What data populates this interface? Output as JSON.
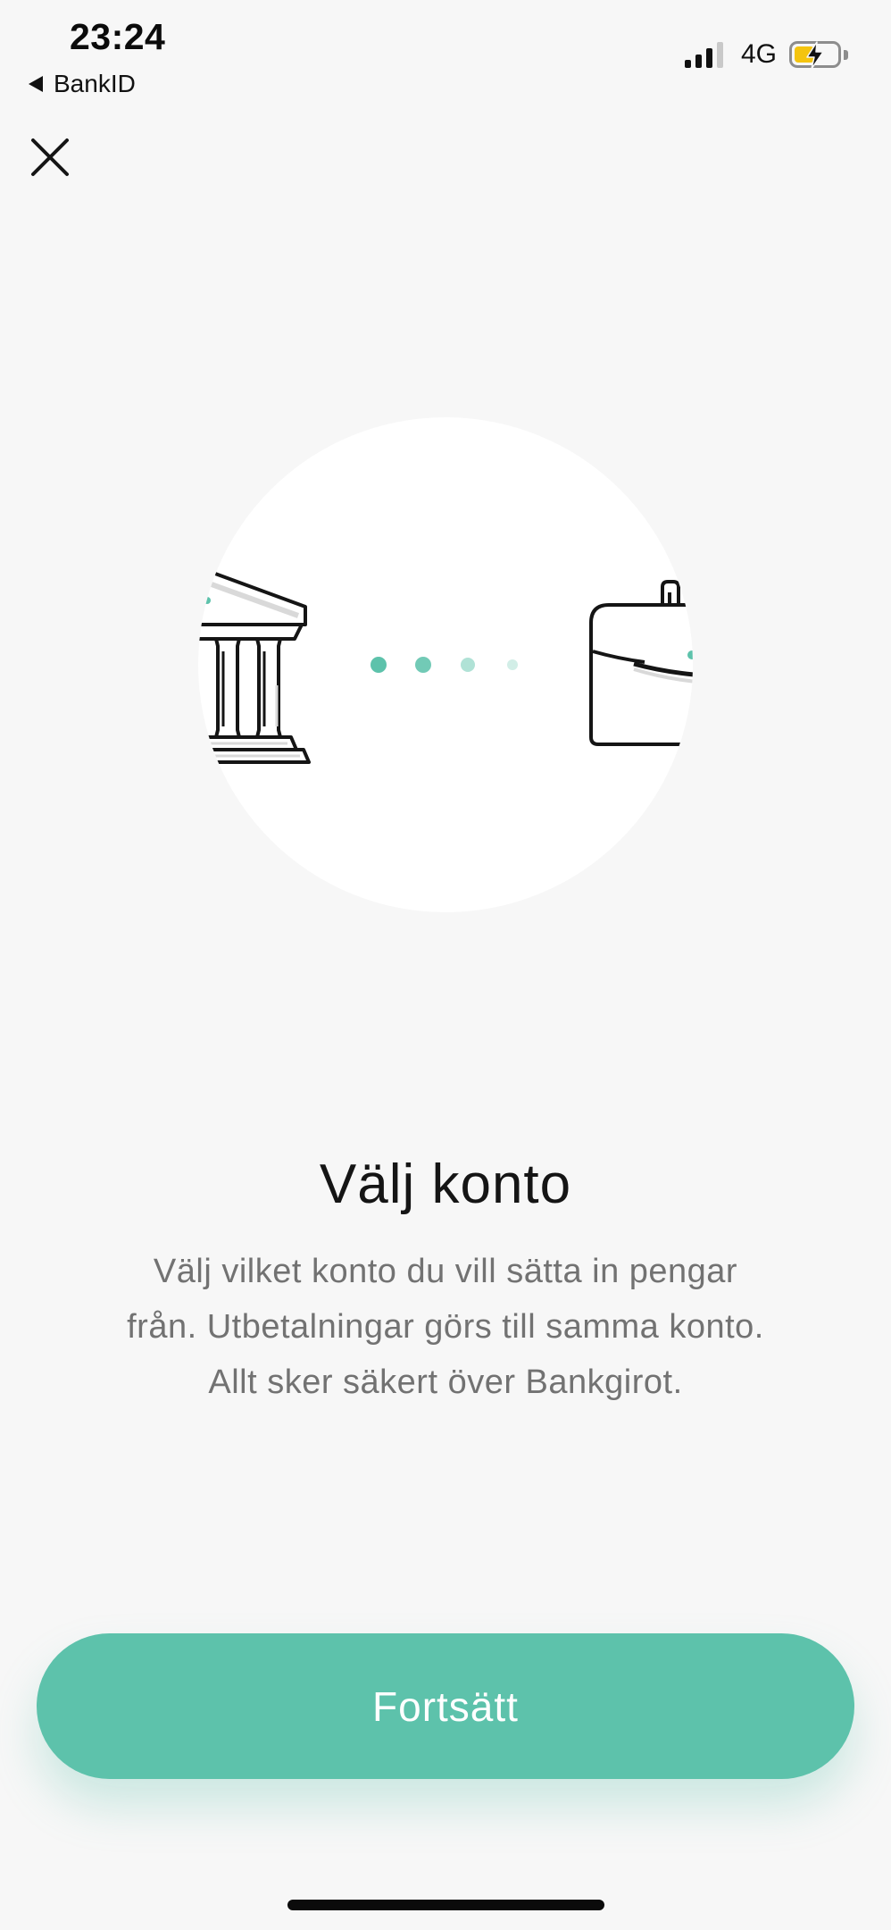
{
  "status_bar": {
    "time": "23:24",
    "back_app_label": "BankID",
    "network": "4G"
  },
  "icons": {
    "close": "close-icon",
    "bank": "bank-icon",
    "briefcase": "briefcase-icon",
    "progress": "dots-progress-icon"
  },
  "colors": {
    "accent": "#5dc2ab",
    "background": "#f7f7f7",
    "battery": "#f4c40f"
  },
  "main": {
    "title": "Välj konto",
    "description_lines": [
      "Välj vilket konto du vill sätta in pengar",
      "från. Utbetalningar görs till samma konto.",
      "Allt sker säkert över Bankgirot."
    ]
  },
  "footer": {
    "continue_label": "Fortsätt"
  }
}
